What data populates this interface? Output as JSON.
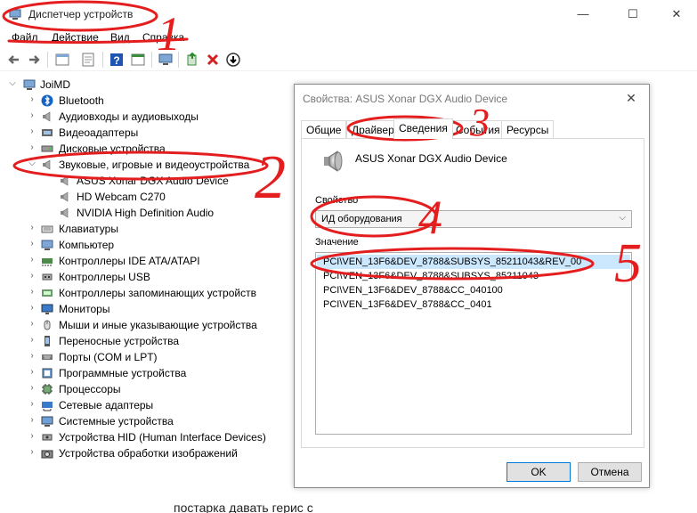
{
  "window": {
    "title": "Диспетчер устройств",
    "controls": [
      "—",
      "☐",
      "✕"
    ]
  },
  "menu": [
    "Файл",
    "Действие",
    "Вид",
    "Справка"
  ],
  "tree": {
    "root": "JoiMD",
    "items": [
      {
        "label": "Bluetooth",
        "icon": "bluetooth-icon",
        "level": 1,
        "expanded": false
      },
      {
        "label": "Аудиовходы и аудиовыходы",
        "icon": "speaker-icon",
        "level": 1,
        "expanded": false
      },
      {
        "label": "Видеоадаптеры",
        "icon": "display-adapter-icon",
        "level": 1,
        "expanded": false
      },
      {
        "label": "Дисковые устройства",
        "icon": "disk-icon",
        "level": 1,
        "expanded": false
      },
      {
        "label": "Звуковые, игровые и видеоустройства",
        "icon": "speaker-icon",
        "level": 1,
        "expanded": true
      },
      {
        "label": "ASUS Xonar DGX Audio Device",
        "icon": "speaker-icon",
        "level": 2
      },
      {
        "label": "HD Webcam C270",
        "icon": "speaker-icon",
        "level": 2
      },
      {
        "label": "NVIDIA High Definition Audio",
        "icon": "speaker-icon",
        "level": 2
      },
      {
        "label": "Клавиатуры",
        "icon": "keyboard-icon",
        "level": 1,
        "expanded": false
      },
      {
        "label": "Компьютер",
        "icon": "computer-icon",
        "level": 1,
        "expanded": false
      },
      {
        "label": "Контроллеры IDE ATA/ATAPI",
        "icon": "ide-controller-icon",
        "level": 1,
        "expanded": false
      },
      {
        "label": "Контроллеры USB",
        "icon": "usb-icon",
        "level": 1,
        "expanded": false
      },
      {
        "label": "Контроллеры запоминающих устройств",
        "icon": "storage-controller-icon",
        "level": 1,
        "expanded": false
      },
      {
        "label": "Мониторы",
        "icon": "monitor-icon",
        "level": 1,
        "expanded": false
      },
      {
        "label": "Мыши и иные указывающие устройства",
        "icon": "mouse-icon",
        "level": 1,
        "expanded": false
      },
      {
        "label": "Переносные устройства",
        "icon": "portable-device-icon",
        "level": 1,
        "expanded": false
      },
      {
        "label": "Порты (COM и LPT)",
        "icon": "port-icon",
        "level": 1,
        "expanded": false
      },
      {
        "label": "Программные устройства",
        "icon": "software-device-icon",
        "level": 1,
        "expanded": false
      },
      {
        "label": "Процессоры",
        "icon": "processor-icon",
        "level": 1,
        "expanded": false
      },
      {
        "label": "Сетевые адаптеры",
        "icon": "network-adapter-icon",
        "level": 1,
        "expanded": false
      },
      {
        "label": "Системные устройства",
        "icon": "system-device-icon",
        "level": 1,
        "expanded": false
      },
      {
        "label": "Устройства HID (Human Interface Devices)",
        "icon": "hid-icon",
        "level": 1,
        "expanded": false
      },
      {
        "label": "Устройства обработки изображений",
        "icon": "camera-icon",
        "level": 1,
        "expanded": false
      }
    ]
  },
  "dialog": {
    "title": "Свойства: ASUS Xonar DGX Audio Device",
    "tabs": [
      "Общие",
      "Драйвер",
      "Сведения",
      "События",
      "Ресурсы"
    ],
    "active_tab": "Сведения",
    "device_name": "ASUS Xonar DGX Audio Device",
    "property_label": "Свойство",
    "property_value": "ИД оборудования",
    "values_label": "Значение",
    "values": [
      "PCI\\VEN_13F6&DEV_8788&SUBSYS_85211043&REV_00",
      "PCI\\VEN_13F6&DEV_8788&SUBSYS_85211043",
      "PCI\\VEN_13F6&DEV_8788&CC_040100",
      "PCI\\VEN_13F6&DEV_8788&CC_0401"
    ],
    "ok_label": "OK",
    "cancel_label": "Отмена"
  },
  "annotations": [
    "1",
    "2",
    "3",
    "4",
    "5"
  ],
  "annotation_color": "#e41e1e",
  "bottom_text": "постарка давать герис с"
}
